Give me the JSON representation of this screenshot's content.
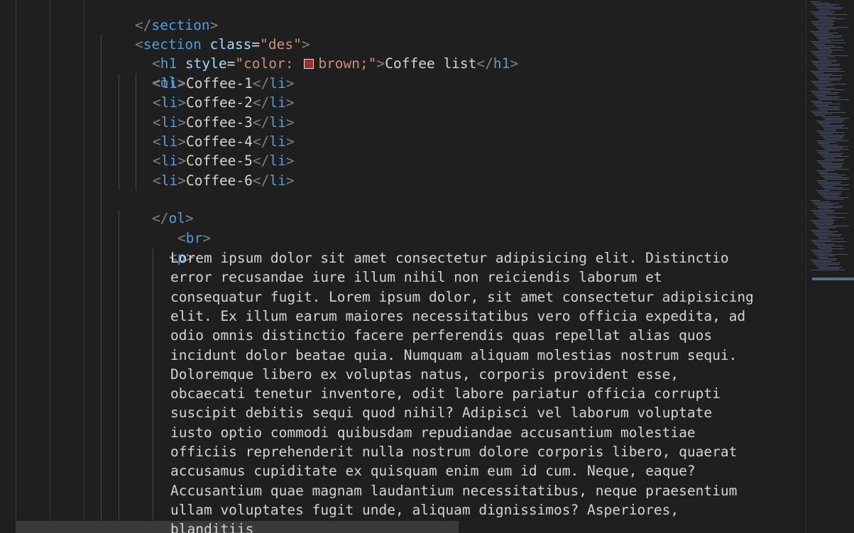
{
  "editor": {
    "lines": {
      "l0": {
        "open": "</",
        "tag": "section",
        "close": ">"
      },
      "l1": {
        "open": "<",
        "tag": "section",
        "attr": " class",
        "eq": "=",
        "val": "\"des\"",
        "close": ">"
      },
      "l2": {
        "open": "<",
        "tag": "h1",
        "attr": " style",
        "eq": "=",
        "val1": "\"color: ",
        "val2": "brown;\"",
        "close": ">",
        "text": "Coffee list",
        "end_open": "</",
        "end_tag": "h1",
        "end_close": ">"
      },
      "l3": {
        "open": "<",
        "tag": "ol",
        "close": ">"
      },
      "items": [
        {
          "text": "Coffee-1"
        },
        {
          "text": "Coffee-2"
        },
        {
          "text": "Coffee-3"
        },
        {
          "text": "Coffee-4"
        },
        {
          "text": "Coffee-5"
        },
        {
          "text": "Coffee-6"
        }
      ],
      "li": {
        "open": "<",
        "tag": "li",
        "close": ">",
        "end_open": "</"
      },
      "l10": {
        "open": "</",
        "tag": "ol",
        "close": ">"
      },
      "l11": {
        "open": "<",
        "tag": "br",
        "close": ">"
      },
      "l12": {
        "open": "<",
        "tag": "p",
        "close": ">"
      },
      "paragraph": [
        "Lorem ipsum dolor sit amet consectetur adipisicing elit. Distinctio",
        "error recusandae iure illum nihil non reiciendis laborum et",
        "consequatur fugit. Lorem ipsum dolor, sit amet consectetur adipisicing",
        "elit. Ex illum earum maiores necessitatibus vero officia expedita, ad",
        "odio omnis distinctio facere perferendis quas repellat alias quos",
        "incidunt dolor beatae quia. Numquam aliquam molestias nostrum sequi.",
        "Doloremque libero ex voluptas natus, corporis provident esse,",
        "obcaecati tenetur inventore, odit labore pariatur officia corrupti",
        "suscipit debitis sequi quod nihil? Adipisci vel laborum voluptate",
        "iusto optio commodi quibusdam repudiandae accusantium molestiae",
        "officiis reprehenderit nulla nostrum dolore corporis libero, quaerat",
        "accusamus cupiditate ex quisquam enim eum id cum. Neque, eaque?",
        "Accusantium quae magnam laudantium necessitatibus, neque praesentium",
        "ullam voluptates fugit unde, aliquam dignissimos? Asperiores,",
        "blanditiis"
      ]
    },
    "swatch_color": "#a52a2a"
  }
}
